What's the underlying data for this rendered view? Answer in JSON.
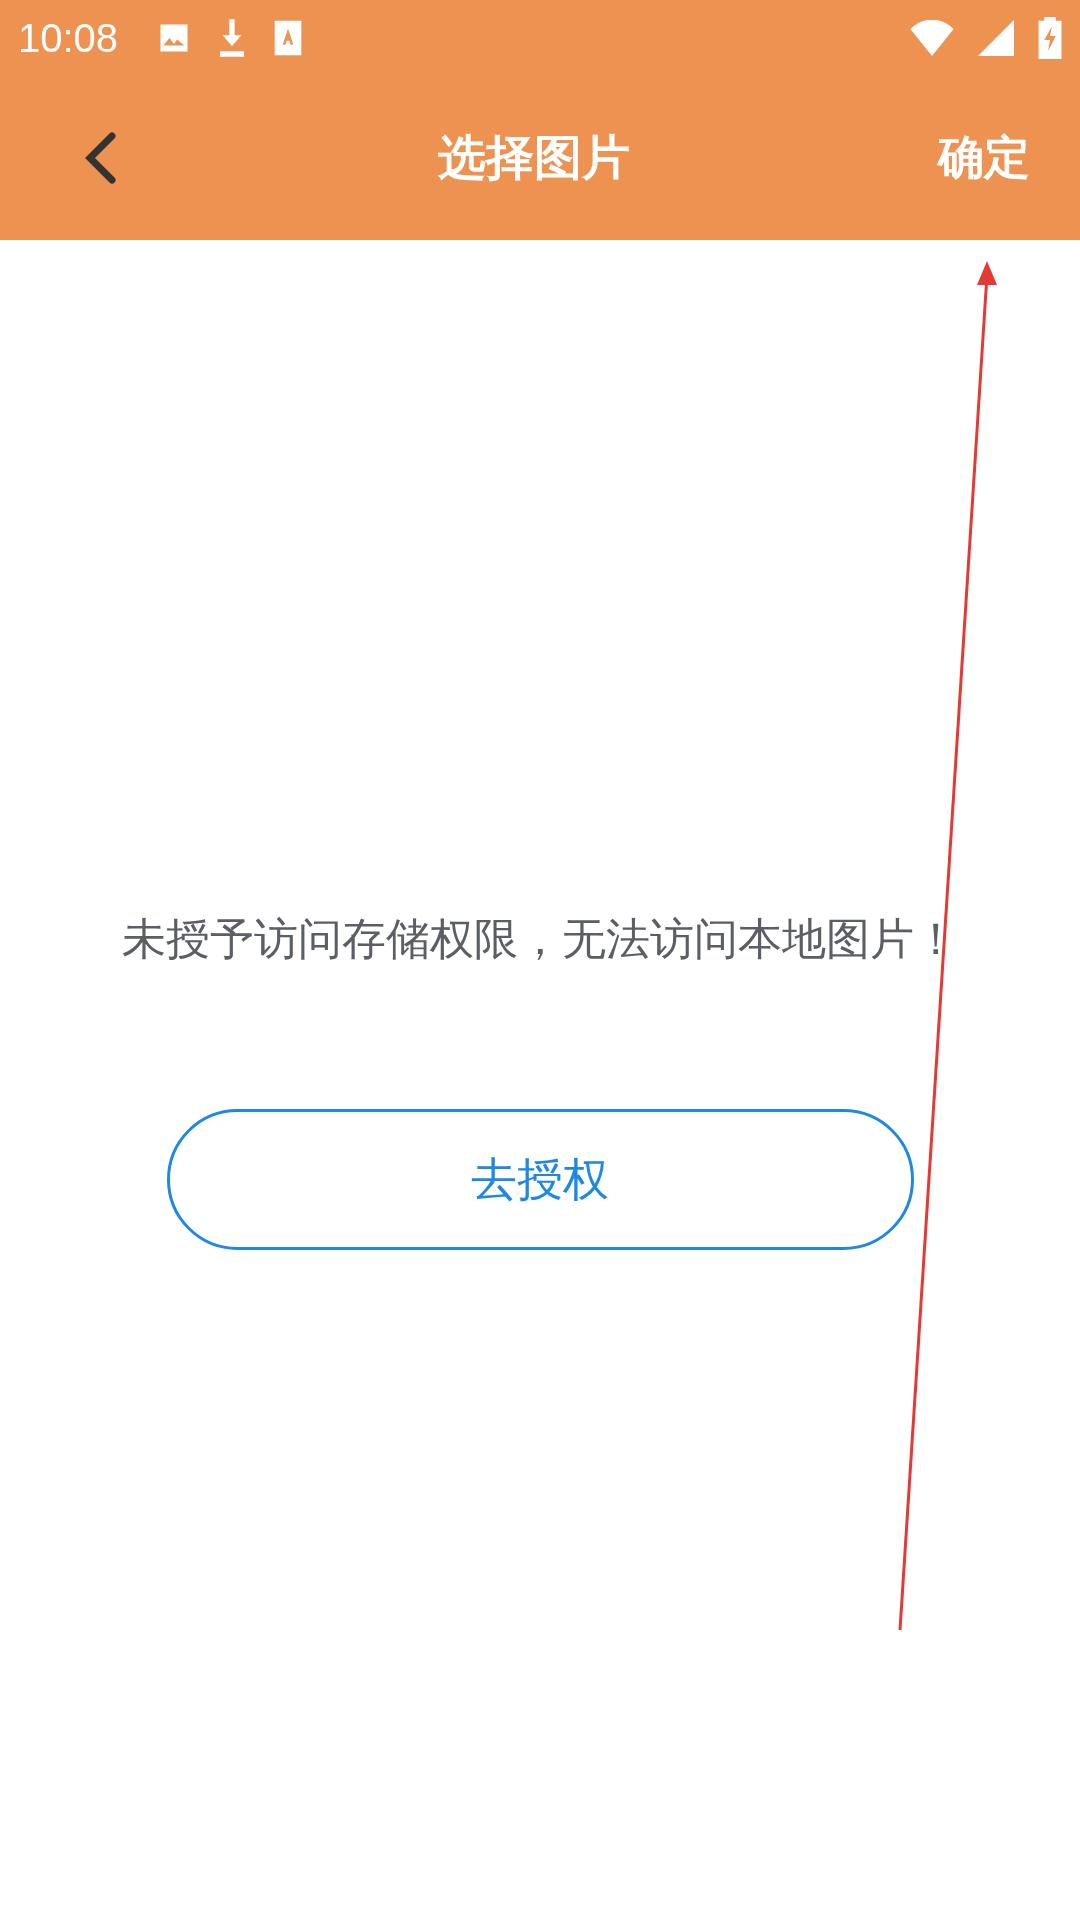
{
  "status_bar": {
    "time": "10:08"
  },
  "header": {
    "title": "选择图片",
    "confirm": "确定"
  },
  "message": "未授予访问存储权限，无法访问本地图片！",
  "authorize_button": "去授权"
}
